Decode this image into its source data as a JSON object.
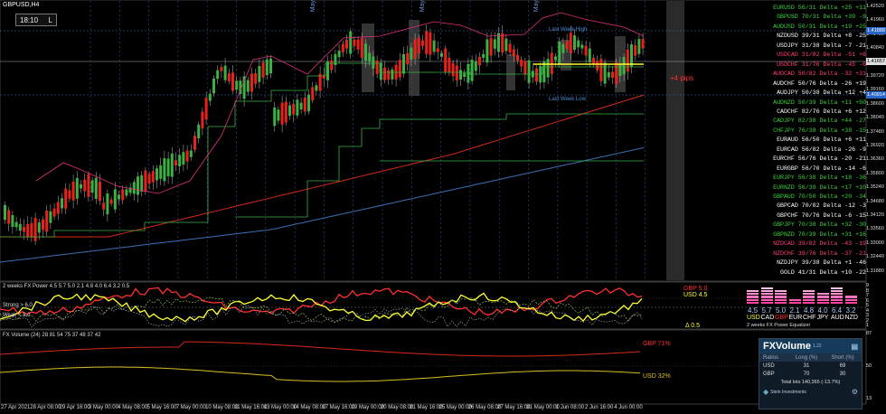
{
  "chart": {
    "symbol_label": "GBPUSD,H4",
    "clock": "18:10",
    "clock_btn": "L",
    "pip_note": "+4 pips",
    "last_week_high": "Last Week High",
    "last_week_low": "Last Week Low",
    "month_label": "May",
    "current_price_tag": "1.41657",
    "blue_tag_top": "1.41888",
    "blue_tag_low": "1.40914",
    "price_ticks": [
      "1.42520",
      "1.41960",
      "1.41400",
      "1.40840",
      "1.40280",
      "1.39720",
      "1.39160",
      "1.38600",
      "1.38040",
      "1.37480",
      "1.36920",
      "1.36360",
      "1.35800",
      "1.35240",
      "1.34680",
      "1.34120",
      "1.33560",
      "1.33000",
      "1.32440",
      "1.31880"
    ],
    "dates": [
      "27 Apr 2021",
      "28 Apr 08:00",
      "29 Apr 16:00",
      "3 May 00:00",
      "4 May 08:00",
      "5 May 16:00",
      "7 May 00:00",
      "10 May 08:00",
      "11 May 16:00",
      "13 May 00:00",
      "14 May 08:00",
      "17 May 16:00",
      "19 May 00:00",
      "20 May 08:00",
      "21 May 16:00",
      "25 May 00:00",
      "26 May 08:00",
      "27 May 16:00",
      "31 May 00:00",
      "1 Jun 08:00",
      "2 Jun 16:00",
      "4 Jun 00:00"
    ],
    "colors": {
      "up": "#3cb043",
      "down": "#e8211b",
      "ma_red": "#d42a1a",
      "ma_blue": "#3a6fb0",
      "yellow": "#ffff33"
    }
  },
  "watchlist": [
    {
      "text": "EURUSD  56/31 Delta +25  +11",
      "color": "#3cd23c"
    },
    {
      "text": "GBPUSD  70/31 Delta +39  -9",
      "color": "#3cd23c"
    },
    {
      "text": "AUDUSD  50/31 Delta +19  +25",
      "color": "#3cd23c"
    },
    {
      "text": "NZDUSD  39/31 Delta  +8  -25",
      "color": "#ffffff"
    },
    {
      "text": "USDJPY  31/38 Delta  -7  -21",
      "color": "#ffffff"
    },
    {
      "text": "USDCAD  31/82 Delta -51  +6",
      "color": "#ff4070"
    },
    {
      "text": "USDCHF  31/76 Delta -45  -6",
      "color": "#ff4070"
    },
    {
      "text": "AUDCAD  50/82 Delta -32  +31",
      "color": "#ff4070"
    },
    {
      "text": "AUDCHF  50/76 Delta -26  +19",
      "color": "#ffffff"
    },
    {
      "text": "AUDJPY  50/38 Delta +12  +4",
      "color": "#ffffff"
    },
    {
      "text": "AUDNZD  50/39 Delta +11  +50",
      "color": "#3cd23c"
    },
    {
      "text": "CADCHF  82/76 Delta  +6  +12",
      "color": "#ffffff"
    },
    {
      "text": "CADJPY  82/38 Delta +44  -27",
      "color": "#3cd23c"
    },
    {
      "text": "CHFJPY  76/38 Delta +38  -15",
      "color": "#3cd23c"
    },
    {
      "text": "EURAUD  56/50 Delta  +6  +11",
      "color": "#ffffff"
    },
    {
      "text": "EURCAD  56/82 Delta -26  -9",
      "color": "#ffffff"
    },
    {
      "text": "EURCHF  56/76 Delta -20  -21",
      "color": "#ffffff"
    },
    {
      "text": "EURGBP  56/70 Delta -14  -6",
      "color": "#ffffff"
    },
    {
      "text": "EURJPY  56/38 Delta +18  -36",
      "color": "#3cd23c"
    },
    {
      "text": "EURNZD  56/39 Delta +17  +10",
      "color": "#3cd23c"
    },
    {
      "text": "GBPAUD  70/50 Delta +20  -34",
      "color": "#3cd23c"
    },
    {
      "text": "GBPCAD  70/82 Delta -12  -3",
      "color": "#ffffff"
    },
    {
      "text": "GBPCHF  70/76 Delta  -6  -15",
      "color": "#ffffff"
    },
    {
      "text": "GBPJPY  70/38 Delta +32  -30",
      "color": "#3cd23c"
    },
    {
      "text": "GBPNZD  70/39 Delta +31  +16",
      "color": "#3cd23c"
    },
    {
      "text": "NZDCAD  39/82 Delta -43  -19",
      "color": "#ff4070"
    },
    {
      "text": "NZDCHF  39/76 Delta -37  -21",
      "color": "#ff4070"
    },
    {
      "text": "NZDJPY  39/38 Delta  +1  -46",
      "color": "#ffffff"
    },
    {
      "text": "GOLD    41/31 Delta +10  -22",
      "color": "#ffffff"
    }
  ],
  "fx_power": {
    "title": "2 weeks FX Power 4.5 5.7 5.0 2.1 4.8 4.0 6.4 3.2 0.5",
    "strong_label": "Strong > 6.0",
    "weak_label": "Weak < 3.0",
    "gbp_label": "GBP 5.0",
    "usd_label": "USD 4.5",
    "delta_label": "Δ 0.5",
    "axis": [
      "9",
      "8",
      "7",
      "6",
      "5",
      "4",
      "3",
      "2",
      "1"
    ],
    "currencies": [
      "USD",
      "CAD",
      "GBP",
      "EUR",
      "CHF",
      "JPY",
      "AUD",
      "NZD"
    ],
    "currency_colors": [
      "#ffff33",
      "#ffffff",
      "#ff3030",
      "#ffffff",
      "#ffffff",
      "#ffffff",
      "#ffffff",
      "#ffffff"
    ],
    "values": [
      "4.5",
      "5.7",
      "5.0",
      "2.1",
      "4.8",
      "4.0",
      "6.4",
      "3.2"
    ],
    "levels": [
      4.5,
      5.7,
      5.0,
      2.1,
      4.8,
      4.0,
      6.4,
      3.2
    ],
    "footer": "2 weeks  FX Power  Equalizer"
  },
  "fx_volume": {
    "title": "FX Volume (24) 28 81 54 75 37 48 37 42",
    "gbp_label": "GBP 71%",
    "usd_label": "USD 32%",
    "axis": [
      "87",
      "50",
      "13"
    ],
    "panel": {
      "brand": "FXVolume",
      "version": "1.22",
      "header": [
        "Ratios",
        "Long (%)",
        "Short (%)"
      ],
      "rows": [
        [
          "USD",
          "31",
          "69"
        ],
        [
          "GBP",
          "70",
          "30"
        ]
      ],
      "total": "Total lots 140,365 (-13.7%)",
      "logo": "Stein Investments"
    }
  }
}
